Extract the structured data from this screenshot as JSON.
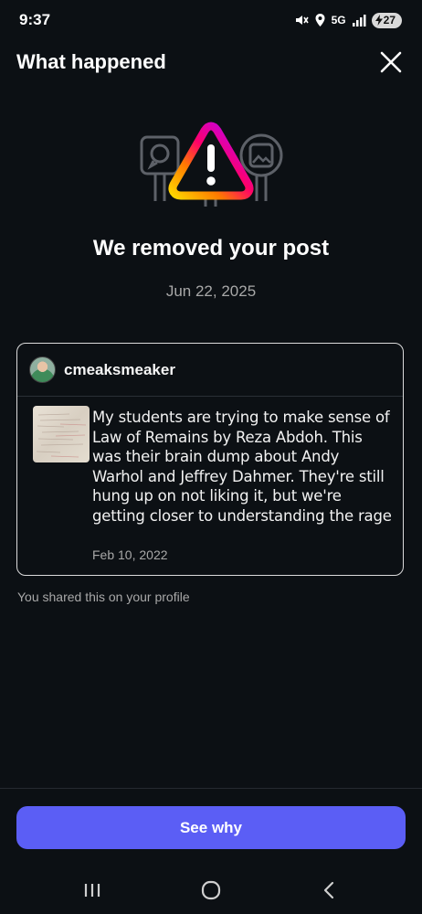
{
  "status_bar": {
    "time": "9:37",
    "network": "5G",
    "battery": "27",
    "icons": [
      "mute-icon",
      "location-icon",
      "signal-icon",
      "charging-icon"
    ]
  },
  "header": {
    "title": "What happened",
    "close_icon": "close-icon"
  },
  "notice": {
    "title": "We removed your post",
    "date": "Jun 22, 2025",
    "illustration_icon": "warning-triangle-icon"
  },
  "post": {
    "username": "cmeaksmeaker",
    "text": "My students are trying to make sense of Law of Remains by Reza Abdoh. This was their brain dump about Andy Warhol and Jeffrey Dahmer. They're still hung up on not liking it, but we're getting closer to understanding the rage",
    "date": "Feb 10, 2022"
  },
  "shared_note": "You shared this on your profile",
  "actions": {
    "see_why_label": "See why"
  },
  "nav": {
    "icons": [
      "recent-apps-icon",
      "home-icon",
      "back-icon"
    ]
  },
  "colors": {
    "background": "#0c1014",
    "button": "#5b5ef5",
    "secondary_text": "#a8a8a8",
    "gradient": [
      "#7638fa",
      "#d300c5",
      "#ff0069",
      "#ff7a00",
      "#ffd600"
    ]
  }
}
